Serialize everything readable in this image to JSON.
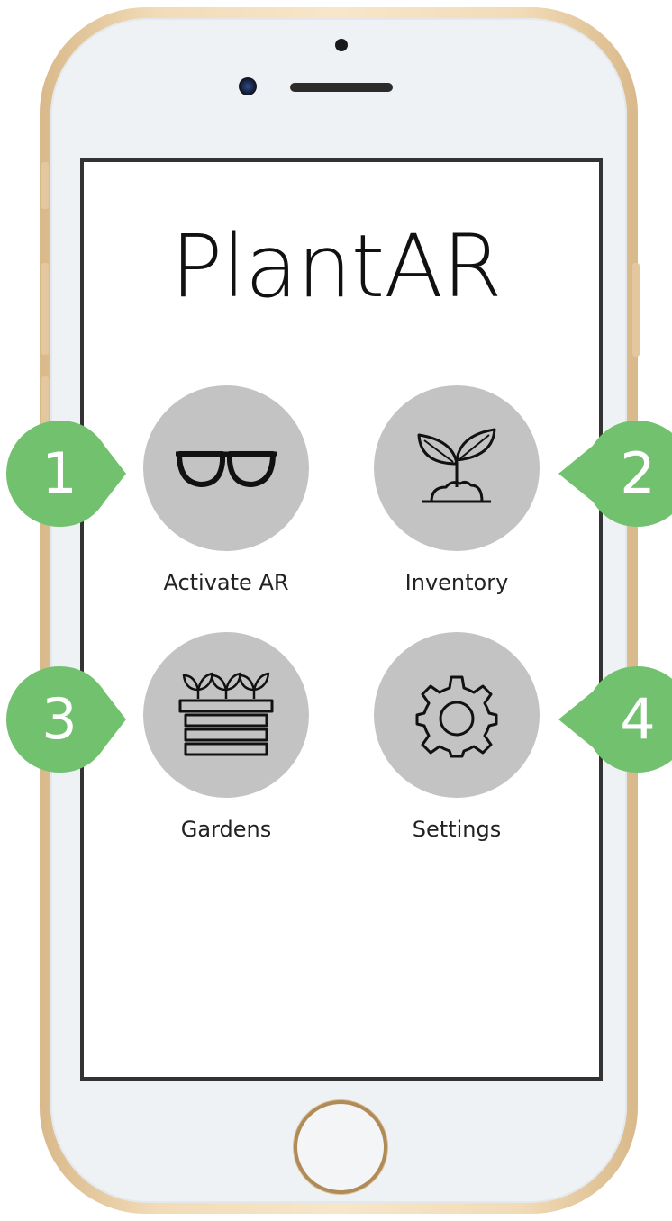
{
  "app": {
    "title": "PlantAR"
  },
  "menu": [
    {
      "label": "Activate AR",
      "icon": "glasses-icon"
    },
    {
      "label": "Inventory",
      "icon": "sprout-icon"
    },
    {
      "label": "Gardens",
      "icon": "planter-box-icon"
    },
    {
      "label": "Settings",
      "icon": "gear-icon"
    }
  ],
  "callouts": [
    "1",
    "2",
    "3",
    "4"
  ],
  "colors": {
    "callout_green": "#72c16f",
    "circle_gray": "#c3c3c3",
    "screen_border": "#333333",
    "phone_gold": "#f2dcb8"
  }
}
